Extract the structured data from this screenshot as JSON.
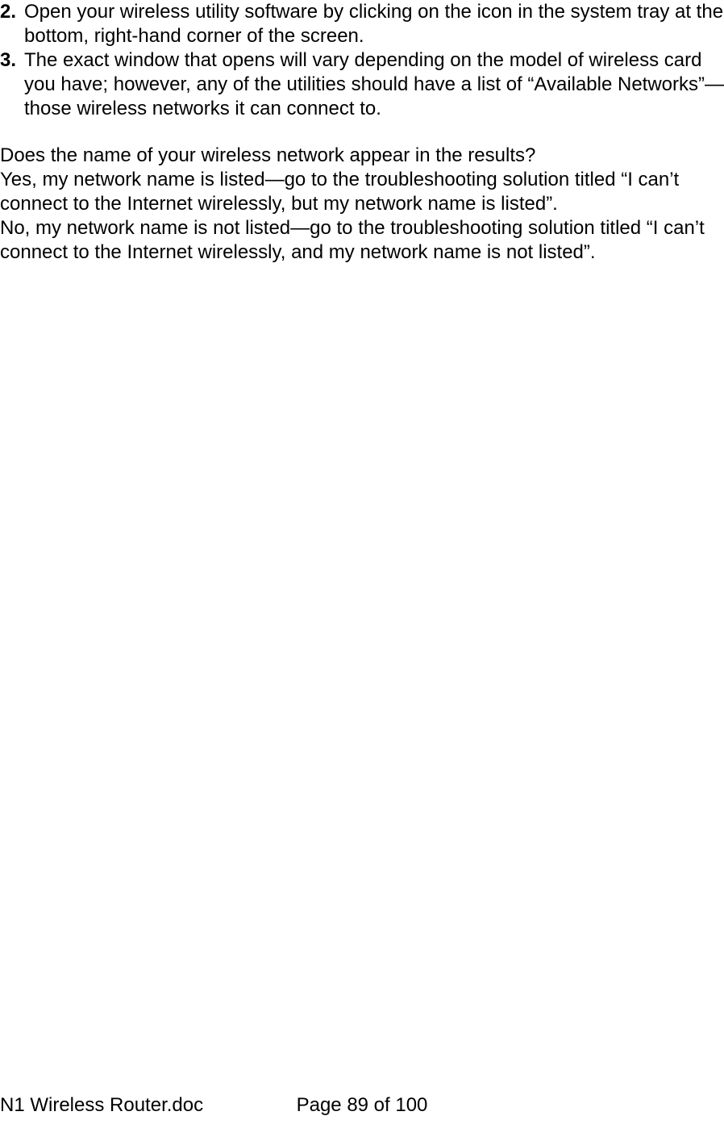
{
  "list": {
    "item2": {
      "number": "2.",
      "text": "Open your wireless utility software by clicking on the icon in the system tray at the bottom, right-hand corner of the screen."
    },
    "item3": {
      "number": "3.",
      "text": "The exact window that opens will vary depending on the model of wireless card you have; however, any of the utilities should have a list of “Available Networks”—those wireless networks it can connect to."
    }
  },
  "body": {
    "question": "Does the name of your wireless network appear in the results?",
    "yes": "Yes, my network name is listed—go to the troubleshooting solution titled “I can’t connect to the Internet wirelessly, but my network name is listed”.",
    "no": "No, my network name is not listed—go to the troubleshooting solution titled “I can’t connect to the Internet wirelessly, and my network name is not listed”."
  },
  "footer": {
    "filename": "N1 Wireless Router.doc",
    "page": "Page 89 of 100"
  }
}
